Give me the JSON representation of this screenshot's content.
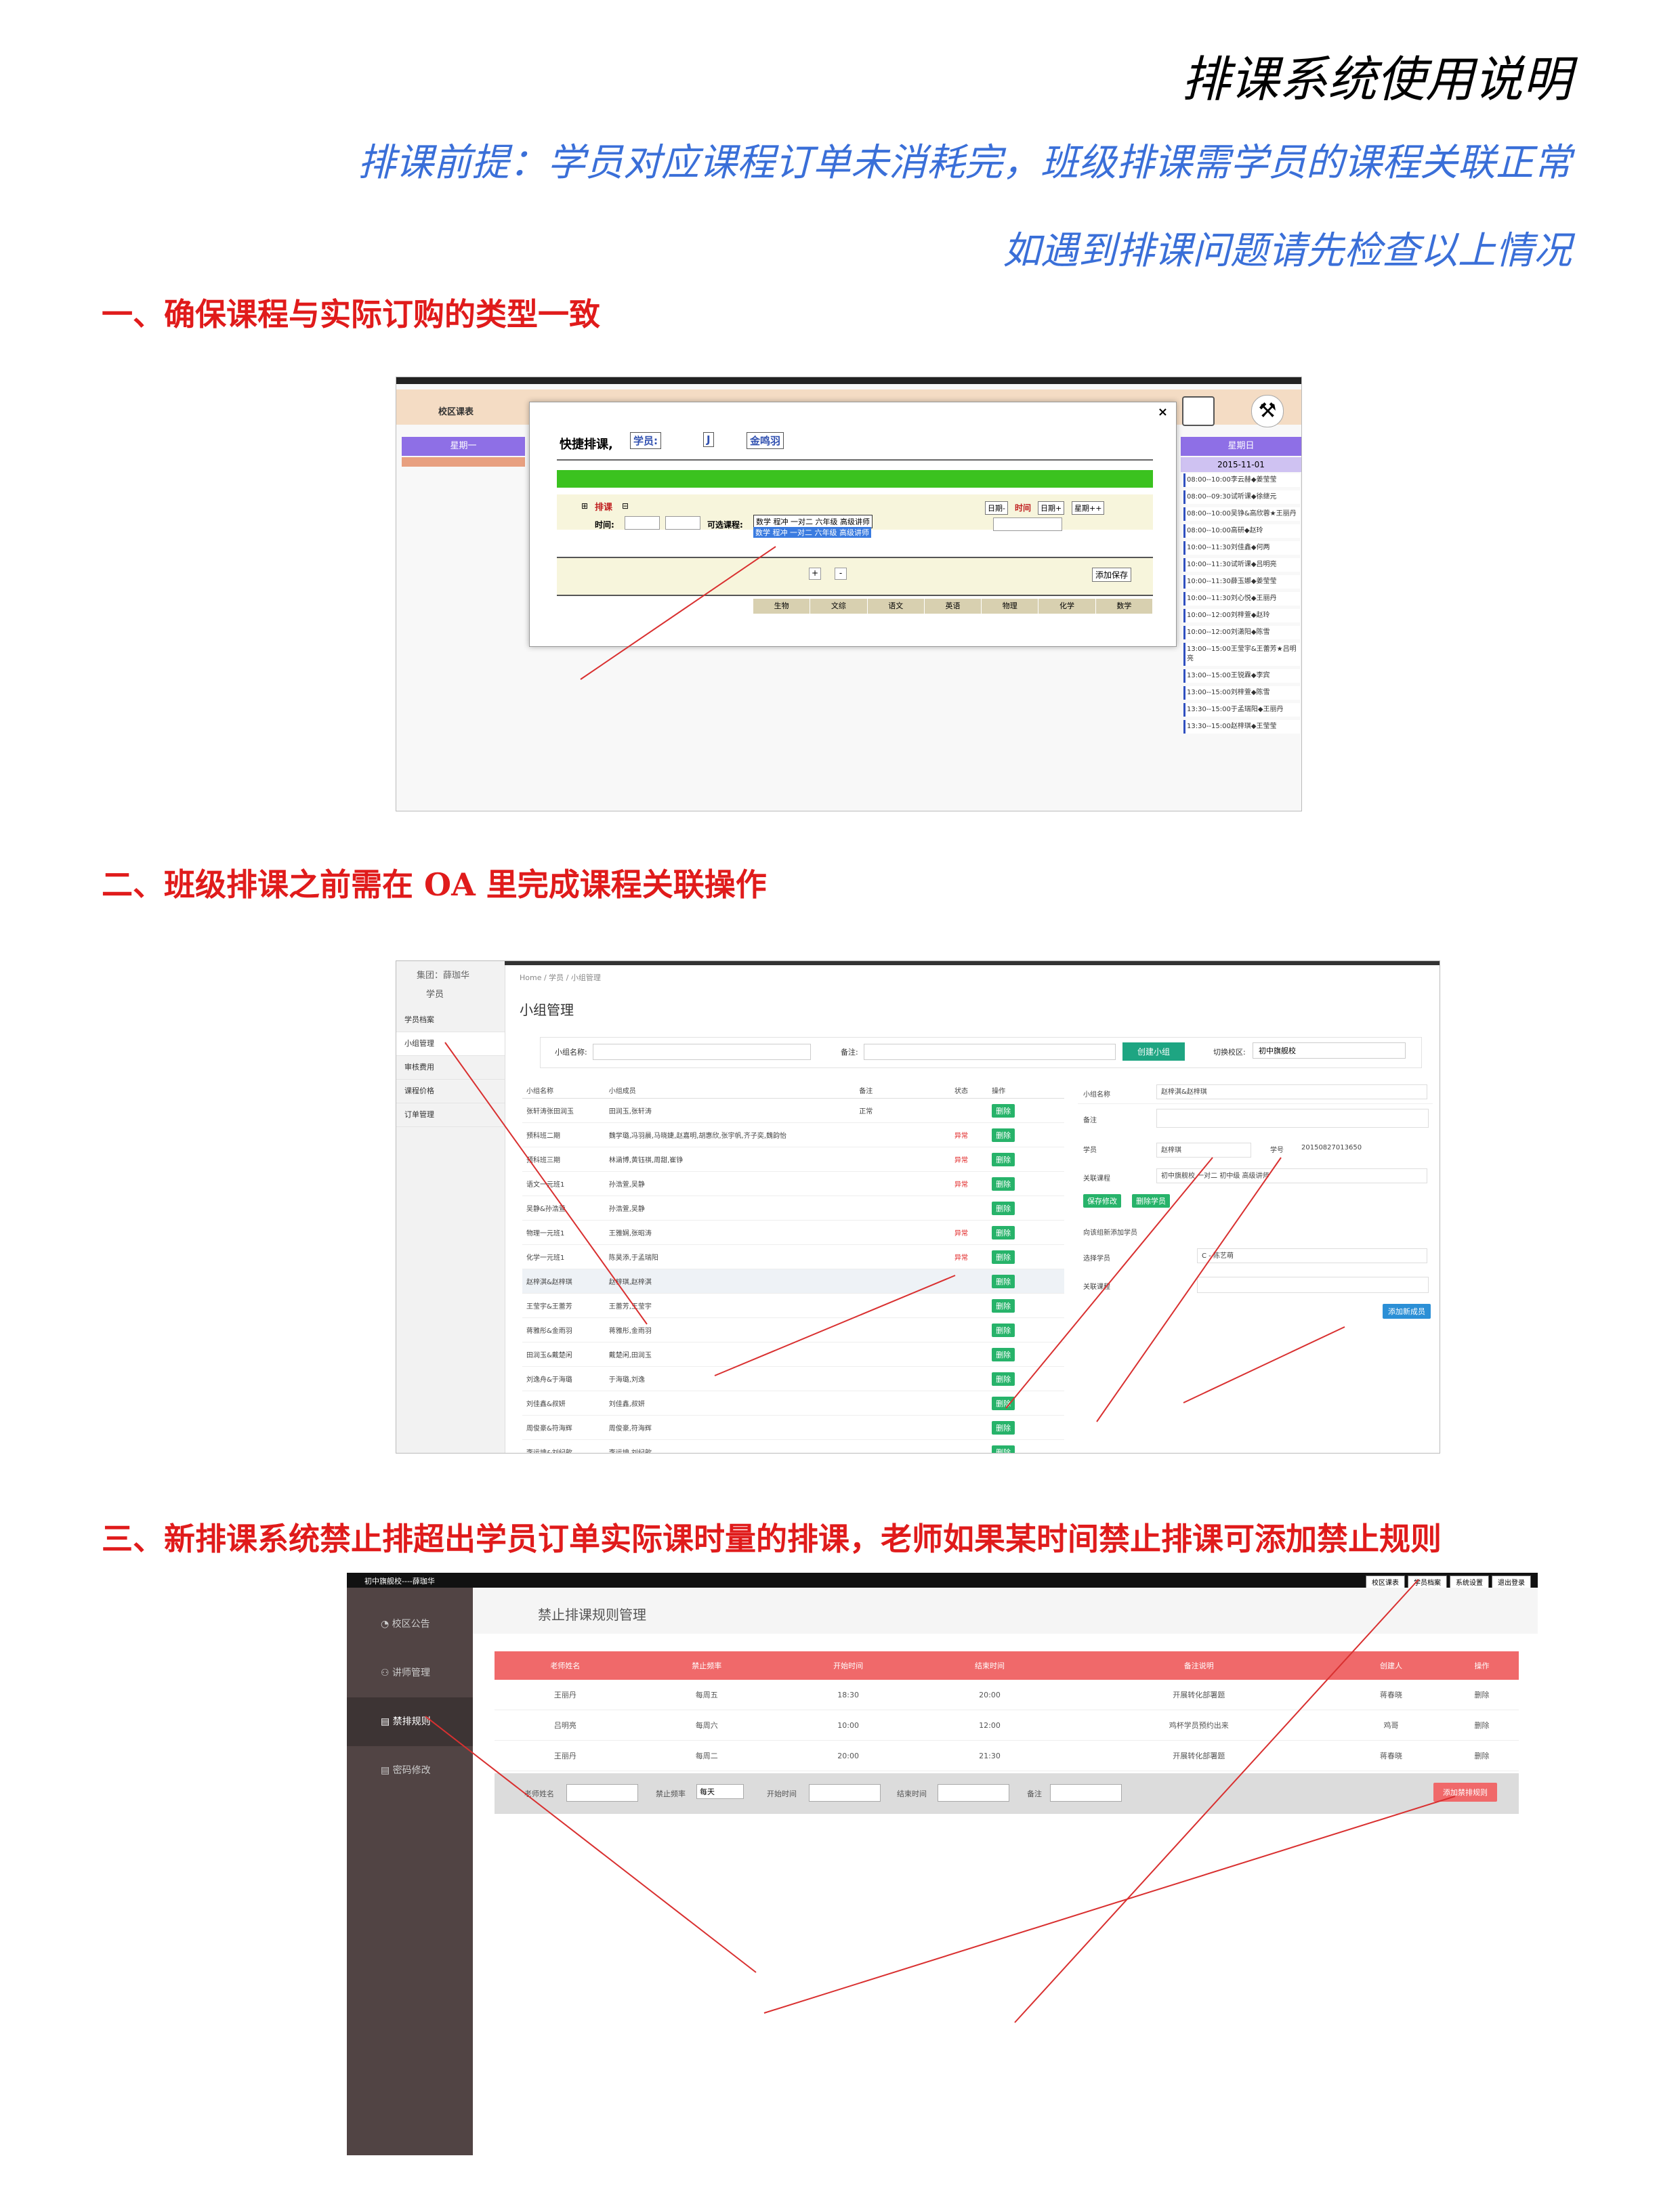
{
  "doc": {
    "title": "排课系统使用说明",
    "subtitle1": "排课前提：学员对应课程订单未消耗完，班级排课需学员的课程关联正常",
    "subtitle2": "如遇到排课问题请先检查以上情况",
    "section1": "一、确保课程与实际订购的类型一致",
    "section2": "二、班级排课之前需在 OA 里完成课程关联操作",
    "section3": "三、新排课系统禁止排超出学员订单实际课时量的排课，老师如果某时间禁止排课可添加禁止规则"
  },
  "shot1": {
    "side_title": "校区课表",
    "weekday_left": "星期一",
    "weekday_right": "星期日",
    "date": "2015-11-01",
    "dialog_title": "快捷排课,",
    "sel1": "学员:",
    "sel2": "J",
    "sel3": "金鸣羽",
    "paike": "排课",
    "time_label": "时间:",
    "course_label": "可选课程:",
    "course_value": "数学 程冲 一对二 六年级 高级讲师",
    "course_hint": "数学 程冲 一对二 六年级 高级讲师",
    "date_minus": "日期-",
    "time_word": "时间",
    "date_plus": "日期+",
    "week_plus": "星期++",
    "save": "添加保存",
    "subjects": [
      "生物",
      "文综",
      "语文",
      "英语",
      "物理",
      "化学",
      "数学"
    ],
    "schedule": [
      "08:00--10:00李云赫◆姜莹莹",
      "08:00--09:30试听课◆徐继元",
      "08:00--10:00吴铮&高欣蓉★王丽丹",
      "08:00--10:00高研◆赵玲",
      "10:00--11:30刘佳鑫◆何两",
      "10:00--11:30试听课◆吕明亮",
      "10:00--11:30薛玉娜◆姜莹莹",
      "10:00--11:30刘心悦◆王丽丹",
      "10:00--12:00刘梓萱◆赵玲",
      "10:00--12:00刘潇阳◆陈雪",
      "13:00--15:00王莹宇&王蕾芳★吕明亮",
      "13:00--15:00王锐霖◆李宾",
      "13:00--15:00刘梓萱◆陈雪",
      "13:30--15:00于孟瑞阳◆王丽丹",
      "13:30--15:00赵梓琪◆王莹莹"
    ]
  },
  "shot2": {
    "top_user": "集团：薛珈华",
    "menu_head": "学员",
    "menu": [
      "学员档案",
      "小组管理",
      "审核费用",
      "课程价格",
      "订单管理"
    ],
    "breadcrumb": "Home / 学员 / 小组管理",
    "page_title": "小组管理",
    "search_name": "小组名称:",
    "search_note": "备注:",
    "create_btn": "创建小组",
    "campus_label": "切换校区:",
    "campus_value": "初中旗舰校",
    "cols": [
      "小组名称",
      "小组成员",
      "备注",
      "状态",
      "操作"
    ],
    "rows": [
      [
        "张轩涛张田润玉",
        "田润玉,张轩涛",
        "正常",
        "",
        "删除"
      ],
      [
        "预科班二期",
        "魏学璐,冯羽晨,马晓婕,赵嘉明,胡惠欣,张宇帆,齐子奕,魏韵怡",
        "",
        "异常",
        "删除"
      ],
      [
        "预科班三期",
        "林涵博,黄钰祺,周甜,崔铮",
        "",
        "异常",
        "删除"
      ],
      [
        "语文一元班1",
        "孙浩萱,吴静",
        "",
        "异常",
        "删除"
      ],
      [
        "吴静&孙浩萱",
        "孙浩萱,吴静",
        "",
        "",
        "删除"
      ],
      [
        "物理一元班1",
        "王雅娴,张昭涛",
        "",
        "异常",
        "删除"
      ],
      [
        "化学一元班1",
        "陈昊添,于孟瑞阳",
        "",
        "异常",
        "删除"
      ],
      [
        "赵梓淇&赵梓琪",
        "赵梓琪,赵梓淇",
        "",
        "",
        "删除"
      ],
      [
        "王莹宇&王蕾芳",
        "王蕾芳,王莹宇",
        "",
        "",
        "删除"
      ],
      [
        "蒋雅彤&金雨羽",
        "蒋雅彤,金雨羽",
        "",
        "",
        "删除"
      ],
      [
        "田润玉&戴楚闲",
        "戴楚闲,田润玉",
        "",
        "",
        "删除"
      ],
      [
        "刘逸舟&于海璐",
        "于海璐,刘逸",
        "",
        "",
        "删除"
      ],
      [
        "刘佳鑫&叔妍",
        "刘佳鑫,叔妍",
        "",
        "",
        "删除"
      ],
      [
        "周俊豪&符海辉",
        "周俊豪,符海辉",
        "",
        "",
        "删除"
      ],
      [
        "李运坤&刘纪歆",
        "李运坤,刘纪歆",
        "",
        "",
        "删除"
      ]
    ],
    "form": {
      "name_label": "小组名称",
      "name_value": "赵梓淇&赵梓琪",
      "note_label": "备注",
      "student_label": "学员",
      "student_value": "赵梓琪",
      "id_label": "学号",
      "id_value": "20150827013650",
      "course_label": "关联课程",
      "course_value": "初中旗舰校 一对二 初中级 高级讲师",
      "save_btn": "保存修改",
      "del_btn": "删除学员",
      "add_title": "向该组新添加学员",
      "pick_label": "选择学员",
      "pick_value": "C - 陈艺萌",
      "req_label": "关联课程",
      "add_btn": "添加新成员"
    }
  },
  "shot3": {
    "app_title": "初中旗舰校----薛珈华",
    "top_btns": [
      "校区课表",
      "学员档案",
      "系统设置",
      "退出登录"
    ],
    "menu": [
      "校区公告",
      "讲师管理",
      "禁排规则",
      "密码修改"
    ],
    "page_title": "禁止排课规则管理",
    "cols": [
      "老师姓名",
      "禁止频率",
      "开始时间",
      "结束时间",
      "备注说明",
      "创建人",
      "操作"
    ],
    "rows": [
      [
        "王丽丹",
        "每周五",
        "18:30",
        "20:00",
        "开展转化部署题",
        "蒋春晓",
        "删除"
      ],
      [
        "吕明亮",
        "每周六",
        "10:00",
        "12:00",
        "鸡杯学员预约出来",
        "鸡哥",
        "删除"
      ],
      [
        "王丽丹",
        "每周二",
        "20:00",
        "21:30",
        "开展转化部署题",
        "蒋春晓",
        "删除"
      ]
    ],
    "f_teacher": "老师姓名",
    "f_freq": "禁止频率",
    "f_freq_value": "每天",
    "f_start": "开始时间",
    "f_end": "结束时间",
    "f_note": "备注",
    "add_btn": "添加禁排规则"
  }
}
